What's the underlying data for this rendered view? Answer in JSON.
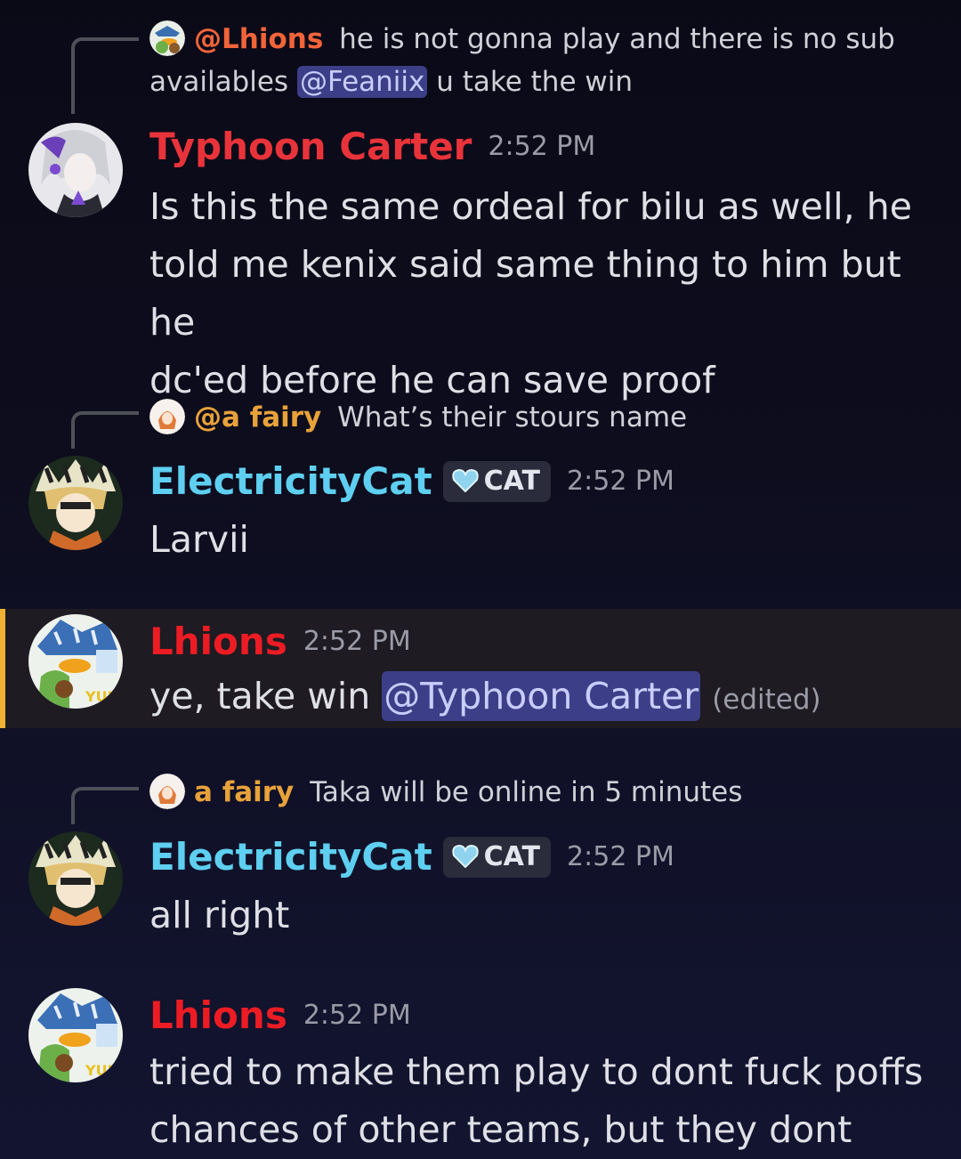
{
  "colors": {
    "typhoon": "#e9333a",
    "electricity": "#5ecff0",
    "lhions": "#ed1c24",
    "lhions_ref": "#f2643a",
    "fairy": "#e8a23a",
    "highlight_bar": "#f0b232",
    "mention_bg": "#3c3f87"
  },
  "messages": [
    {
      "reply": {
        "avatar_icon": "duck-avatar-icon",
        "name": "@Lhions",
        "text_a": " he is not gonna play and there is no sub availables ",
        "mention": "@Feaniix",
        "text_b": "  u take the win"
      },
      "avatar_icon": "anime-girl-avatar-icon",
      "username": "Typhoon Carter",
      "time": "2:52 PM",
      "lines": [
        "Is this the same ordeal for bilu as well, he",
        "told me kenix said same thing to him but he",
        "dc'ed before he can save proof"
      ]
    },
    {
      "reply": {
        "avatar_icon": "fairy-avatar-icon",
        "name": "@a fairy",
        "text": " What’s their stours name"
      },
      "avatar_icon": "cat-boy-avatar-icon",
      "username": "ElectricityCat",
      "tag": "CAT",
      "time": "2:52 PM",
      "text": "Larvii"
    },
    {
      "avatar_icon": "duck-avatar-icon",
      "username": "Lhions",
      "time": "2:52 PM",
      "text": "ye, take win ",
      "mention": "@Typhoon Carter",
      "edited": "(edited)"
    },
    {
      "reply": {
        "avatar_icon": "fairy-avatar-icon",
        "name": "a fairy",
        "text": " Taka will be online in 5 minutes"
      },
      "avatar_icon": "cat-boy-avatar-icon",
      "username": "ElectricityCat",
      "tag": "CAT",
      "time": "2:52 PM",
      "text": "all right"
    },
    {
      "avatar_icon": "duck-avatar-icon",
      "username": "Lhions",
      "time": "2:52 PM",
      "lines": [
        "tried to make them play to dont fuck poffs",
        "chances of other teams, but they dont want"
      ]
    }
  ]
}
